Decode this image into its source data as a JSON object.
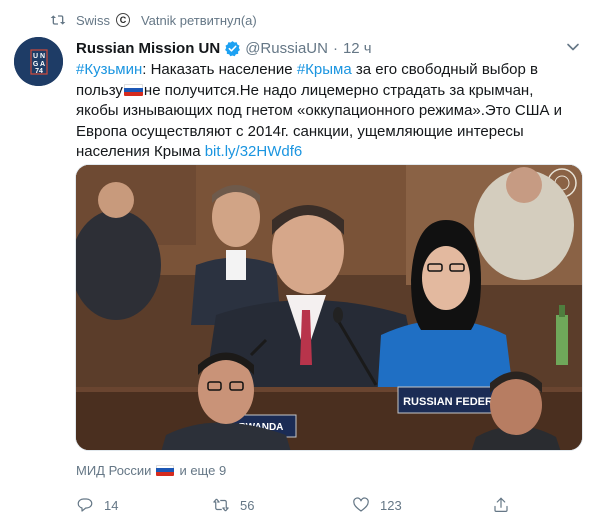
{
  "retweet_bar": {
    "user1": "Swiss",
    "user2_badge": "C",
    "user2": "Vatnik ретвитнул(а)"
  },
  "avatar": {
    "lines": [
      "U N",
      "G A",
      "74"
    ]
  },
  "tweet": {
    "author_name": "Russian Mission UN",
    "handle": "@RussiaUN",
    "dot": "·",
    "time": "12 ч",
    "text": {
      "tag1": "#Кузьмин",
      "t1": ": Наказать население ",
      "tag2": "#Крыма",
      "t2": " за его свободный выбор в пользу",
      "t3": "не получится.Не надо лицемерно страдать за крымчан, якобы изнывающих под гнетом «оккупационного режима».Это США и Европа осуществляют с 2014г. санкции, ущемляющие интересы населения Крыма ",
      "link": "bit.ly/32HWdf6"
    }
  },
  "media": {
    "placard1": "RUSSIAN FEDERA",
    "placard2": "RWANDA"
  },
  "liked_by": {
    "prefix": "МИД России",
    "suffix": "и еще 9"
  },
  "actions": {
    "reply_count": "14",
    "retweet_count": "56",
    "like_count": "123"
  },
  "colors": {
    "accent": "#1b95e0",
    "muted": "#657786",
    "text": "#14171a"
  }
}
